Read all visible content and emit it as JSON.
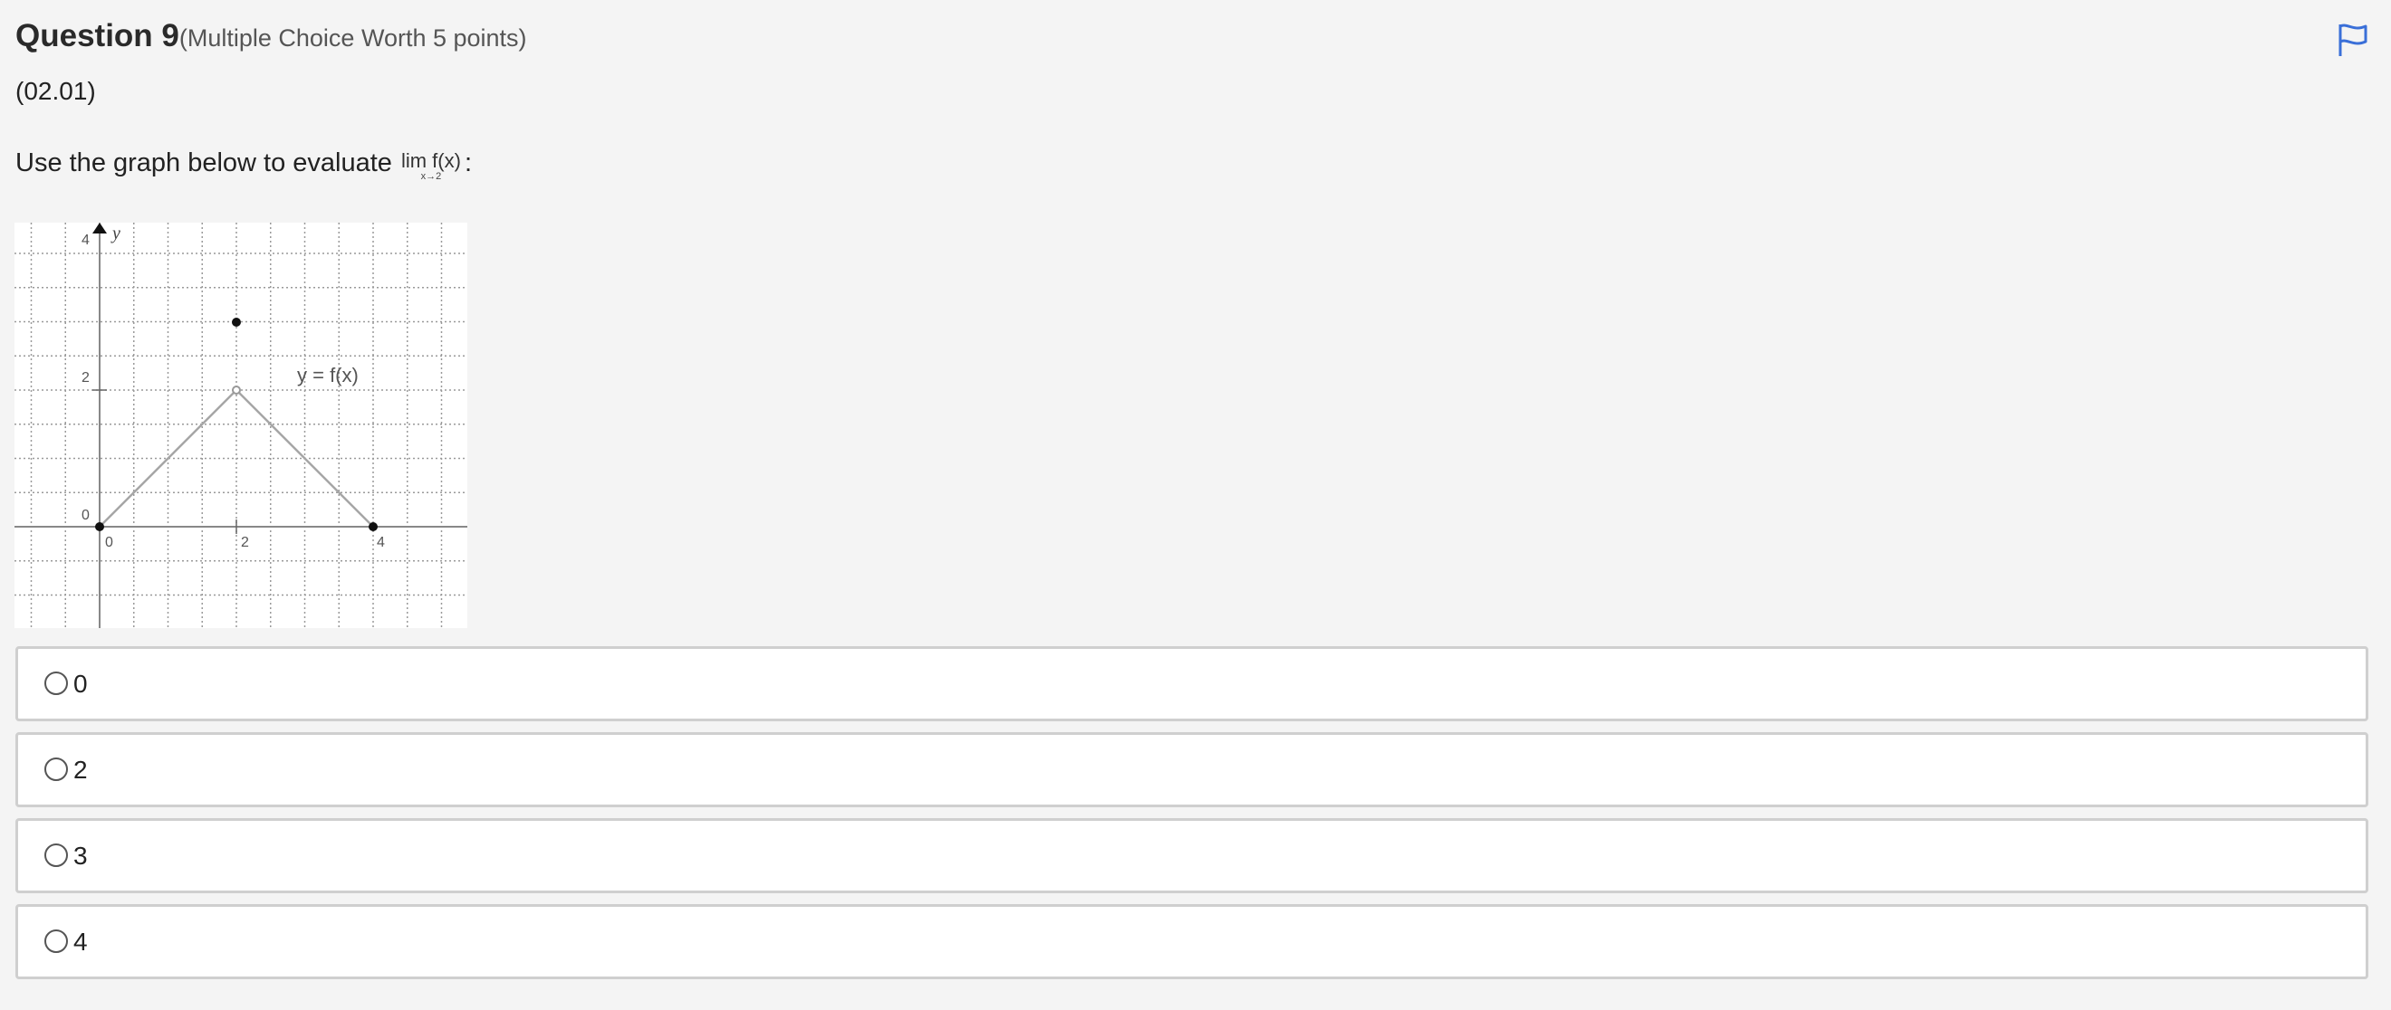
{
  "question": {
    "title": "Question 9",
    "meta": "(Multiple Choice Worth 5 points)",
    "code": "(02.01)",
    "prompt": "Use the graph below to evaluate",
    "limit_expr": "lim f(x)",
    "limit_sub": "x→2",
    "prompt_end": ":"
  },
  "flag": {
    "icon": "flag-icon",
    "color": "#3a6fd8"
  },
  "graph": {
    "function_label": "y = f(x)",
    "axis_y_label": "y",
    "tick_labels": {
      "x0": "0",
      "x2": "2",
      "x4": "4",
      "y0": "0",
      "y2": "2",
      "y4": "4"
    }
  },
  "choices": [
    {
      "label": "0"
    },
    {
      "label": "2"
    },
    {
      "label": "3"
    },
    {
      "label": "4"
    }
  ]
}
